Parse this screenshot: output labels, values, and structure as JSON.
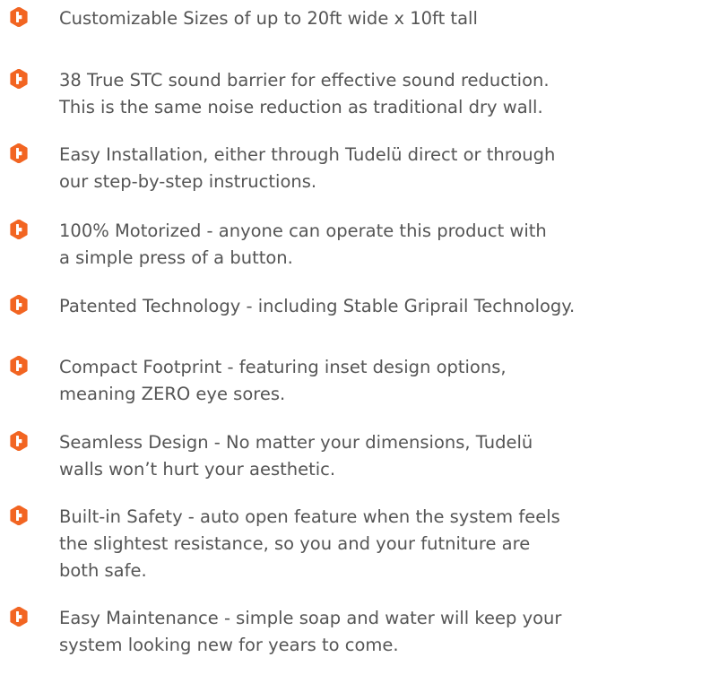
{
  "icon": "tudelu-logo-icon",
  "accent_color": "#f26522",
  "text_color": "#555555",
  "features": [
    {
      "lines": [
        "Customizable Sizes of up to 20ft wide x 10ft tall",
        "",
        ""
      ]
    },
    {
      "lines": [
        "38 True STC sound barrier for effective sound reduction.",
        "This is the same noise reduction as traditional dry wall.",
        ""
      ]
    },
    {
      "lines": [
        "Easy Installation, either through Tudelü direct or through",
        "our step-by-step instructions.",
        ""
      ]
    },
    {
      "lines": [
        "100% Motorized - anyone can operate this product with",
        "a simple press of a button.",
        ""
      ]
    },
    {
      "lines": [
        "Patented Technology - including Stable Griprail Technology.",
        "",
        ""
      ]
    },
    {
      "lines": [
        "Compact Footprint - featuring inset design options,",
        "meaning ZERO eye sores.",
        ""
      ]
    },
    {
      "lines": [
        "Seamless Design - No matter your dimensions, Tudelü",
        "walls won’t hurt your aesthetic.",
        ""
      ]
    },
    {
      "lines": [
        "Built-in Safety - auto open feature when the system feels",
        "the slightest resistance, so you and your futniture are",
        "both safe."
      ]
    },
    {
      "lines": [
        "Easy Maintenance - simple soap and water will keep your",
        "system looking new for years to come.",
        ""
      ]
    }
  ]
}
